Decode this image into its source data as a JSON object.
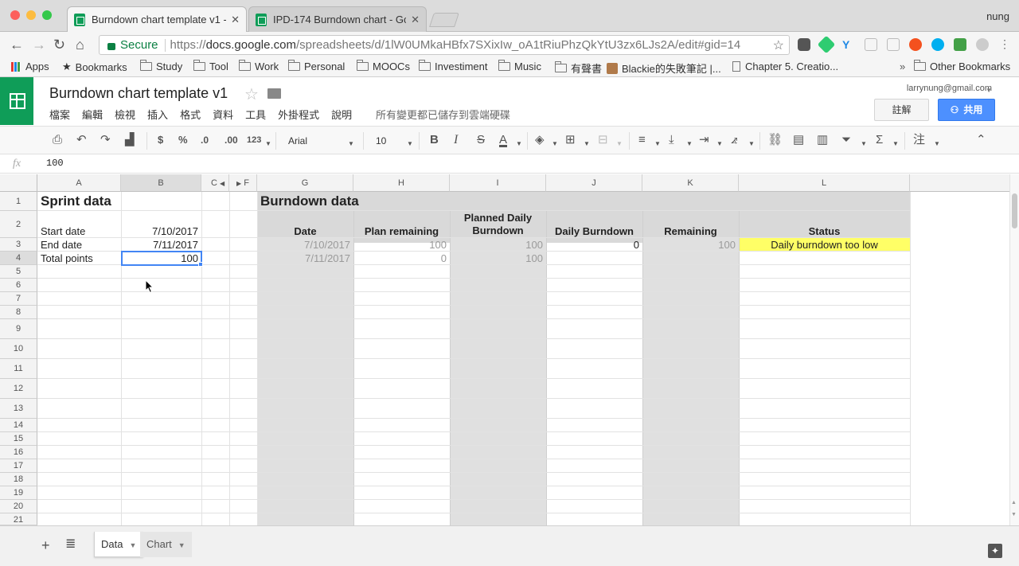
{
  "browser": {
    "tabs": [
      {
        "label": "Burndown chart template v1 -",
        "active": true
      },
      {
        "label": "IPD-174 Burndown chart - Go",
        "active": false
      }
    ],
    "profile": "nung",
    "secure_label": "Secure",
    "url_prefix": "https://",
    "url_host": "docs.google.com",
    "url_path": "/spreadsheets/d/1lW0UMkaHBfx7SXixIw_oA1tRiuPhzQkYtU3zx6LJs2A/edit#gid=14",
    "bookmarks": [
      "Apps",
      "Bookmarks",
      "Study",
      "Tool",
      "Work",
      "Personal",
      "MOOCs",
      "Investiment",
      "Music",
      "有聲書",
      "Blackie的失敗筆記 |...",
      "Chapter 5. Creatio..."
    ],
    "other_bookmarks": "Other Bookmarks",
    "overflow": "»"
  },
  "sheets": {
    "title": "Burndown chart template v1",
    "menu": [
      "檔案",
      "編輯",
      "檢視",
      "插入",
      "格式",
      "資料",
      "工具",
      "外掛程式",
      "說明"
    ],
    "saved_status": "所有變更都已儲存到雲端硬碟",
    "account_email": "larrynung@gmail.com",
    "comment_label": "註解",
    "share_label": "共用",
    "toolbar": {
      "currency": "$",
      "percent": "%",
      "dec_less": ".0",
      "dec_more": ".00",
      "format_more": "123",
      "font": "Arial",
      "font_size": "10",
      "bold": "B",
      "italic": "I",
      "strike": "S",
      "text_color": "A",
      "functions": "Σ",
      "input_tools": "注"
    },
    "formula": {
      "fx": "fx",
      "value": "100"
    },
    "columns": [
      "A",
      "B",
      "C",
      "F",
      "G",
      "H",
      "I",
      "J",
      "K",
      "L"
    ],
    "rows": [
      "1",
      "2",
      "3",
      "4",
      "5",
      "6",
      "7",
      "8",
      "9",
      "10",
      "11",
      "12",
      "13",
      "14",
      "15",
      "16",
      "17",
      "18",
      "19",
      "20",
      "21"
    ],
    "sprint": {
      "heading": "Sprint data",
      "labels": [
        "Start date",
        "End date",
        "Total points"
      ],
      "values": [
        "7/10/2017",
        "7/11/2017",
        "100"
      ]
    },
    "burndown": {
      "heading": "Burndown data",
      "headers": [
        "Date",
        "Plan remaining",
        "Planned Daily Burndown",
        "Daily Burndown",
        "Remaining",
        "Status"
      ],
      "rows": [
        [
          "7/10/2017",
          "100",
          "100",
          "0",
          "100",
          "Daily burndown too low"
        ],
        [
          "7/11/2017",
          "0",
          "100",
          "",
          "",
          ""
        ]
      ],
      "status_color": "#ffff66"
    },
    "sheet_tabs": [
      "Data",
      "Chart"
    ],
    "active_sheet": "Data"
  },
  "colors": {
    "sheets_green": "#0f9d58",
    "share_blue": "#4d90fe",
    "selection_blue": "#4285f4",
    "shade_gray": "#e0e0e0"
  }
}
